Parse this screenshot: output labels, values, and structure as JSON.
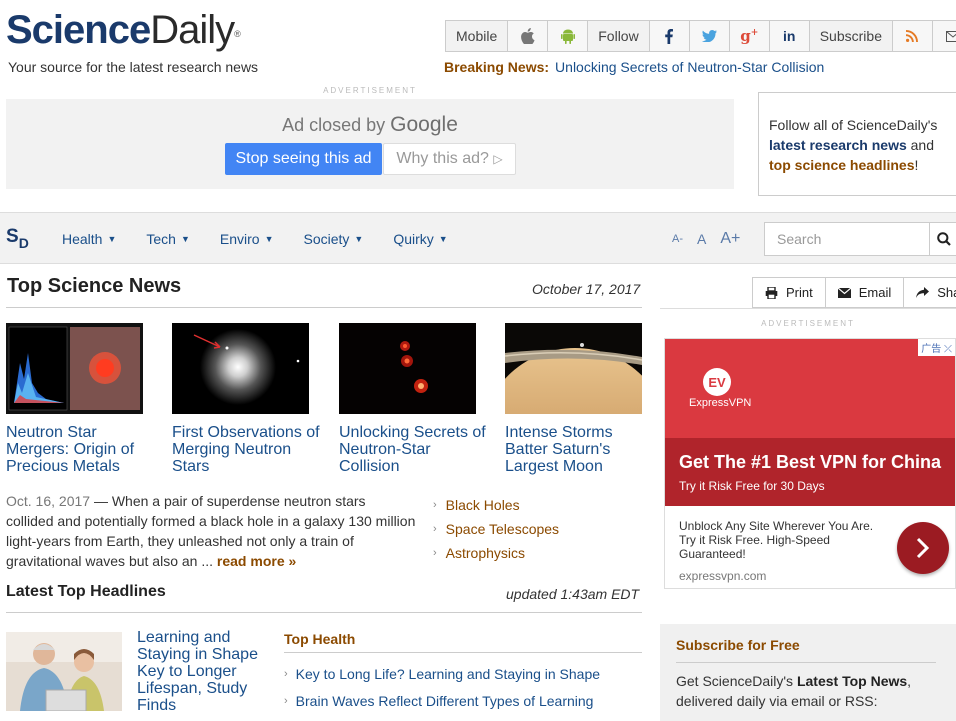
{
  "header": {
    "logo_part1": "Science",
    "logo_part2": "Daily",
    "tagline": "Your source for the latest research news",
    "topbar": {
      "mobile": "Mobile",
      "follow": "Follow",
      "subscribe": "Subscribe"
    },
    "breaking_label": "Breaking News:",
    "breaking_text": "Unlocking Secrets of Neutron-Star Collision"
  },
  "ad_top": {
    "label": "ADVERTISEMENT",
    "closed_text": "Ad closed by",
    "google": "Google",
    "stop_label": "Stop seeing this ad",
    "why_label": "Why this ad?"
  },
  "follow_box": {
    "text1": "Follow all of ScienceDaily's",
    "bold1": "latest research news",
    "text2": "and",
    "bold2": "top science headlines",
    "text3": "!"
  },
  "nav": {
    "sd_s": "S",
    "sd_d": "D",
    "menu": [
      "Health",
      "Tech",
      "Enviro",
      "Society",
      "Quirky"
    ],
    "font_small": "A-",
    "font_normal": "A",
    "font_large": "A+",
    "search_placeholder": "Search"
  },
  "top_news": {
    "title": "Top Science News",
    "date": "October 17, 2017",
    "stories": [
      {
        "title": "Neutron Star Mergers: Origin of Precious Metals"
      },
      {
        "title": "First Observations of Merging Neutron Stars"
      },
      {
        "title": "Unlocking Secrets of Neutron-Star Collision"
      },
      {
        "title": "Intense Storms Batter Saturn's Largest Moon"
      }
    ],
    "summary_date": "Oct. 16, 2017",
    "summary_text": " — When a pair of superdense neutron stars collided and potentially formed a black hole in a galaxy 130 million light-years from Earth, they unleashed not only a train of gravitational waves but also an ...",
    "read_more": "read more »",
    "topics": [
      "Black Holes",
      "Space Telescopes",
      "Astrophysics"
    ]
  },
  "latest": {
    "title": "Latest Top Headlines",
    "updated": "updated 1:43am EDT",
    "lead_title": "Learning and Staying in Shape Key to Longer Lifespan, Study Finds",
    "top_health_label": "Top Health",
    "top_health": [
      "Key to Long Life? Learning and Staying in Shape",
      "Brain Waves Reflect Different Types of Learning"
    ]
  },
  "tools": {
    "print": "Print",
    "email": "Email",
    "share": "Share"
  },
  "ad_right": {
    "label": "ADVERTISEMENT",
    "adchoice": "广告",
    "brand": "ExpressVPN",
    "logo_letters": "EV",
    "headline": "Get The #1 Best VPN for China",
    "subhead": "Try it Risk Free for 30 Days",
    "body": "Unblock Any Site Wherever You Are. Try it Risk Free. High-Speed Guaranteed!",
    "url": "expressvpn.com"
  },
  "subscribe": {
    "title": "Subscribe for Free",
    "text1": "Get ScienceDaily's ",
    "bold": "Latest Top News",
    "text2": ", delivered daily via email or RSS:"
  },
  "colors": {
    "brand_blue": "#1a3a6b",
    "link_blue": "#1a4f8a",
    "accent_brown": "#8b4a00",
    "vpn_red": "#da3940",
    "google_blue": "#4285f4"
  }
}
